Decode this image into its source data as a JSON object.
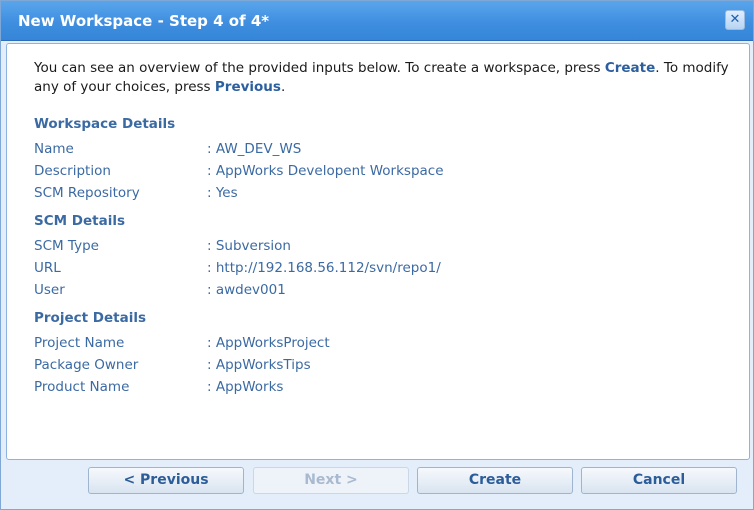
{
  "dialog": {
    "title": "New Workspace - Step 4 of 4*",
    "close_glyph": "✕"
  },
  "intro": {
    "part1": "You can see an overview of the provided inputs below. To create a workspace, press ",
    "create_kw": "Create",
    "part2": ". To modify any of your choices, press ",
    "previous_kw": "Previous",
    "part3": "."
  },
  "sections": {
    "workspace": {
      "title": "Workspace Details",
      "rows": [
        {
          "label": "Name",
          "value": ": AW_DEV_WS"
        },
        {
          "label": "Description",
          "value": ": AppWorks Developent Workspace"
        },
        {
          "label": "SCM Repository",
          "value": ": Yes"
        }
      ]
    },
    "scm": {
      "title": "SCM Details",
      "rows": [
        {
          "label": "SCM Type",
          "value": ": Subversion"
        },
        {
          "label": "URL",
          "value": ": http://192.168.56.112/svn/repo1/"
        },
        {
          "label": "User",
          "value": ": awdev001"
        }
      ]
    },
    "project": {
      "title": "Project Details",
      "rows": [
        {
          "label": "Project Name",
          "value": ": AppWorksProject"
        },
        {
          "label": "Package Owner",
          "value": ": AppWorksTips"
        },
        {
          "label": "Product Name",
          "value": ": AppWorks"
        }
      ]
    }
  },
  "buttons": {
    "previous": "< Previous",
    "next": "Next >",
    "create": "Create",
    "cancel": "Cancel"
  },
  "colors": {
    "titlebar": "#3f8ee0",
    "label_text": "#3b6aa3",
    "keyword_text": "#2c5f9e"
  }
}
